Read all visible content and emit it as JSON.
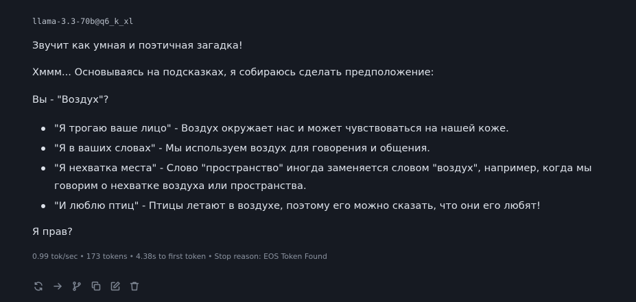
{
  "message": {
    "model_name": "llama-3.3-70b@q6_k_xl",
    "paragraphs": {
      "intro": "Звучит как умная и поэтичная загадка!",
      "reasoning": "Хммм... Основываясь на подсказках, я собираюсь сделать предположение:",
      "guess": "Вы - \"Воздух\"?",
      "closing": "Я прав?"
    },
    "bullets": [
      "\"Я трогаю ваше лицо\" - Воздух окружает нас и может чувствоваться на нашей коже.",
      "\"Я в ваших словах\" - Мы используем воздух для говорения и общения.",
      "\"Я нехватка места\" - Слово \"пространство\" иногда заменяется словом \"воздух\", например, когда мы говорим о нехватке воздуха или пространства.",
      "\"И люблю птиц\" - Птицы летают в воздухе, поэтому его можно сказать, что они его любят!"
    ],
    "stats": {
      "speed": "0.99 tok/sec",
      "tokens": "173 tokens",
      "first_token": "4.38s to first token",
      "stop_reason": "Stop reason: EOS Token Found",
      "separator": "•"
    }
  },
  "toolbar": {
    "icons": [
      "regenerate-icon",
      "continue-arrow-icon",
      "branch-icon",
      "copy-icon",
      "edit-icon",
      "delete-icon"
    ]
  },
  "colors": {
    "background": "#161a22",
    "text": "#dde2ea",
    "muted": "#8b93a0",
    "icon": "#7d8592"
  }
}
